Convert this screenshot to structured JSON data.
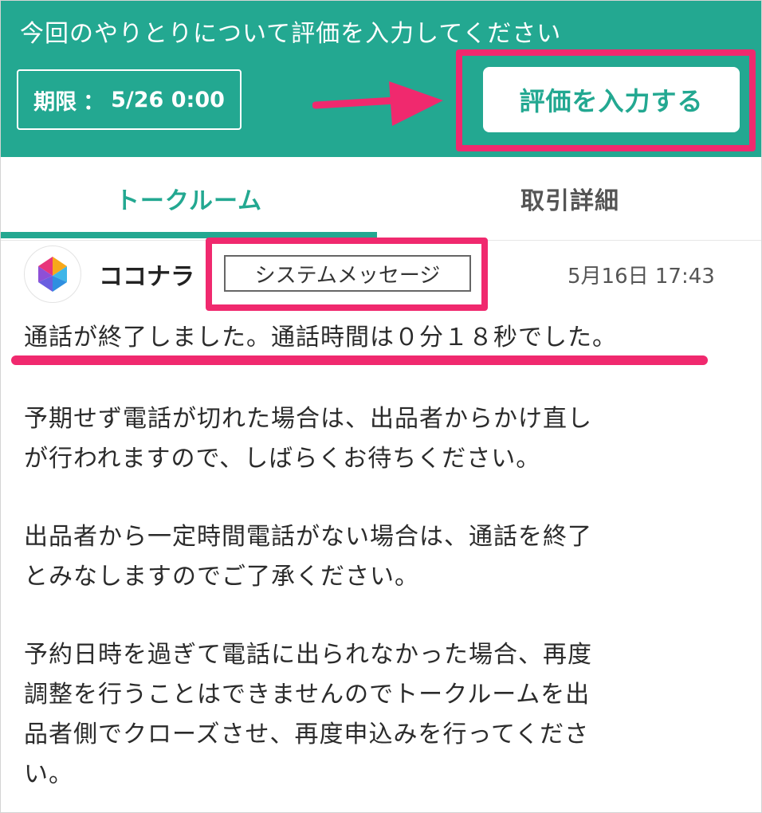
{
  "header": {
    "title": "今回のやりとりについて評価を入力してください",
    "deadline_label": "期限",
    "deadline_sep": "：",
    "deadline_value": "5/26 0:00",
    "rate_button": "評価を入力する",
    "color": "#23a891"
  },
  "tabs": [
    {
      "label": "トークルーム",
      "active": true
    },
    {
      "label": "取引詳細",
      "active": false
    }
  ],
  "message": {
    "sender": "ココナラ",
    "badge": "システムメッセージ",
    "timestamp": "5月16日 17:43",
    "avatar_icon": "coconala-logo-icon",
    "lines": [
      "通話が終了しました。通話時間は０分１８秒でした。",
      "予期せず電話が切れた場合は、出品者からかけ直し",
      "が行われますので、しばらくお待ちください。",
      "出品者から一定時間電話がない場合は、通話を終了",
      "とみなしますのでご了承ください。",
      "予約日時を過ぎて電話に出られなかった場合、再度",
      "調整を行うことはできませんのでトークルームを出",
      "品者側でクローズさせ、再度申込みを行ってくださ",
      "い。"
    ]
  },
  "highlight_color": "#f0296e"
}
